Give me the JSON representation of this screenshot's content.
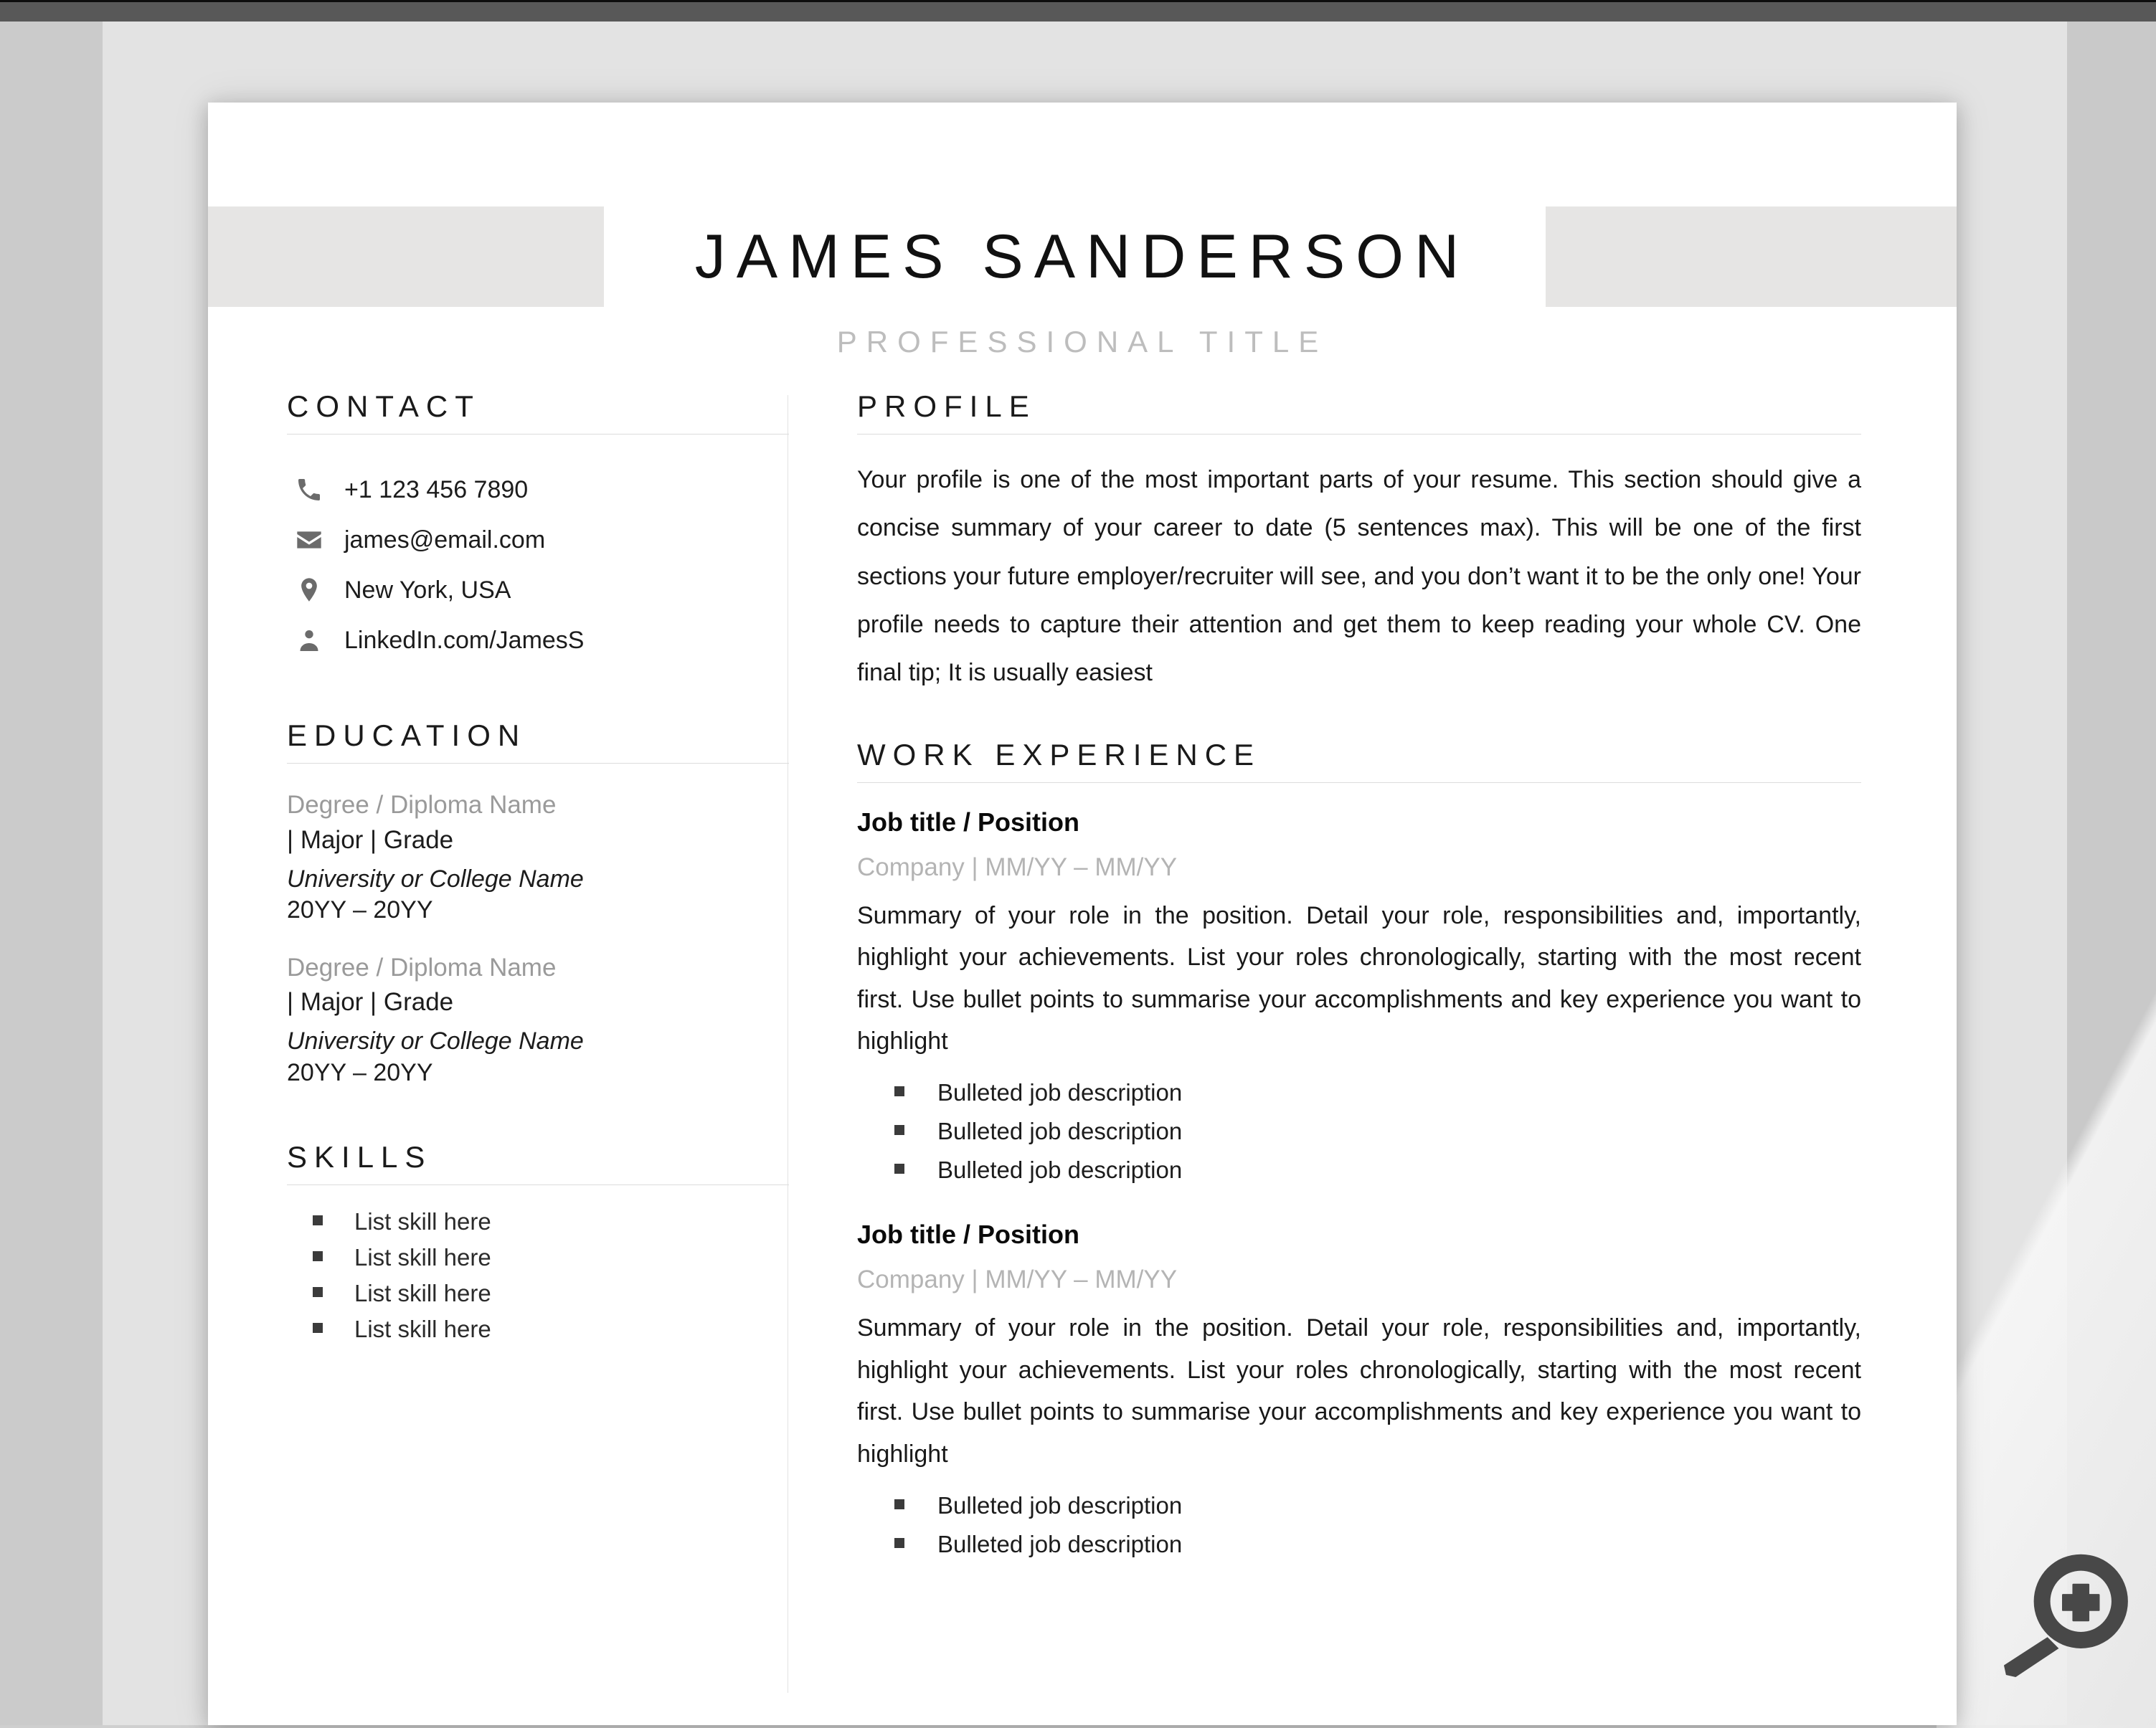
{
  "viewer": {
    "zoom_icon": "magnifier-plus-icon"
  },
  "resume": {
    "name": "JAMES SANDERSON",
    "professional_title": "PROFESSIONAL TITLE",
    "contact": {
      "heading": "CONTACT",
      "items": [
        {
          "icon": "phone-icon",
          "value": "+1 123 456 7890"
        },
        {
          "icon": "envelope-icon",
          "value": "james@email.com"
        },
        {
          "icon": "location-pin-icon",
          "value": "New York, USA"
        },
        {
          "icon": "person-icon",
          "value": "LinkedIn.com/JamesS"
        }
      ]
    },
    "education": {
      "heading": "EDUCATION",
      "entries": [
        {
          "degree": "Degree / Diploma Name",
          "major": "| Major | Grade",
          "school": "University or College Name",
          "years": "20YY – 20YY"
        },
        {
          "degree": "Degree / Diploma Name",
          "major": "| Major | Grade",
          "school": "University or College Name",
          "years": "20YY – 20YY"
        }
      ]
    },
    "skills": {
      "heading": "SKILLS",
      "items": [
        "List skill here",
        "List skill here",
        "List skill here",
        "List skill here"
      ]
    },
    "profile": {
      "heading": "PROFILE",
      "text": "Your profile is one of the most important parts of your resume. This section should give a concise summary of your career to date (5 sentences max). This will be one of the first sections your future employer/recruiter will see, and you don’t want it to be the only one! Your profile needs to capture their attention and get them to keep reading your whole CV. One final tip; It is usually easiest"
    },
    "work_experience": {
      "heading": "WORK EXPERIENCE",
      "jobs": [
        {
          "title": "Job title / Position",
          "meta": "Company |  MM/YY – MM/YY",
          "summary": "Summary of your role in the position. Detail your role, responsibilities and, importantly, highlight your achievements. List your roles chronologically, starting with the most recent first. Use bullet points to summarise your accomplishments and key experience you want to highlight",
          "bullets": [
            "Bulleted job description",
            "Bulleted job description",
            "Bulleted job description"
          ]
        },
        {
          "title": "Job title / Position",
          "meta": "Company |  MM/YY – MM/YY",
          "summary": "Summary of your role in the position. Detail your role, responsibilities and, importantly, highlight your achievements. List your roles chronologically, starting with the most recent first. Use bullet points to summarise your accomplishments and key experience you want to highlight",
          "bullets": [
            "Bulleted job description",
            "Bulleted job description"
          ]
        }
      ]
    }
  },
  "colors": {
    "page_background": "#ffffff",
    "band_gray": "#e6e5e4",
    "muted_text": "#9a9a9a",
    "meta_text": "#b4b4b4",
    "topbar": "#585858"
  }
}
